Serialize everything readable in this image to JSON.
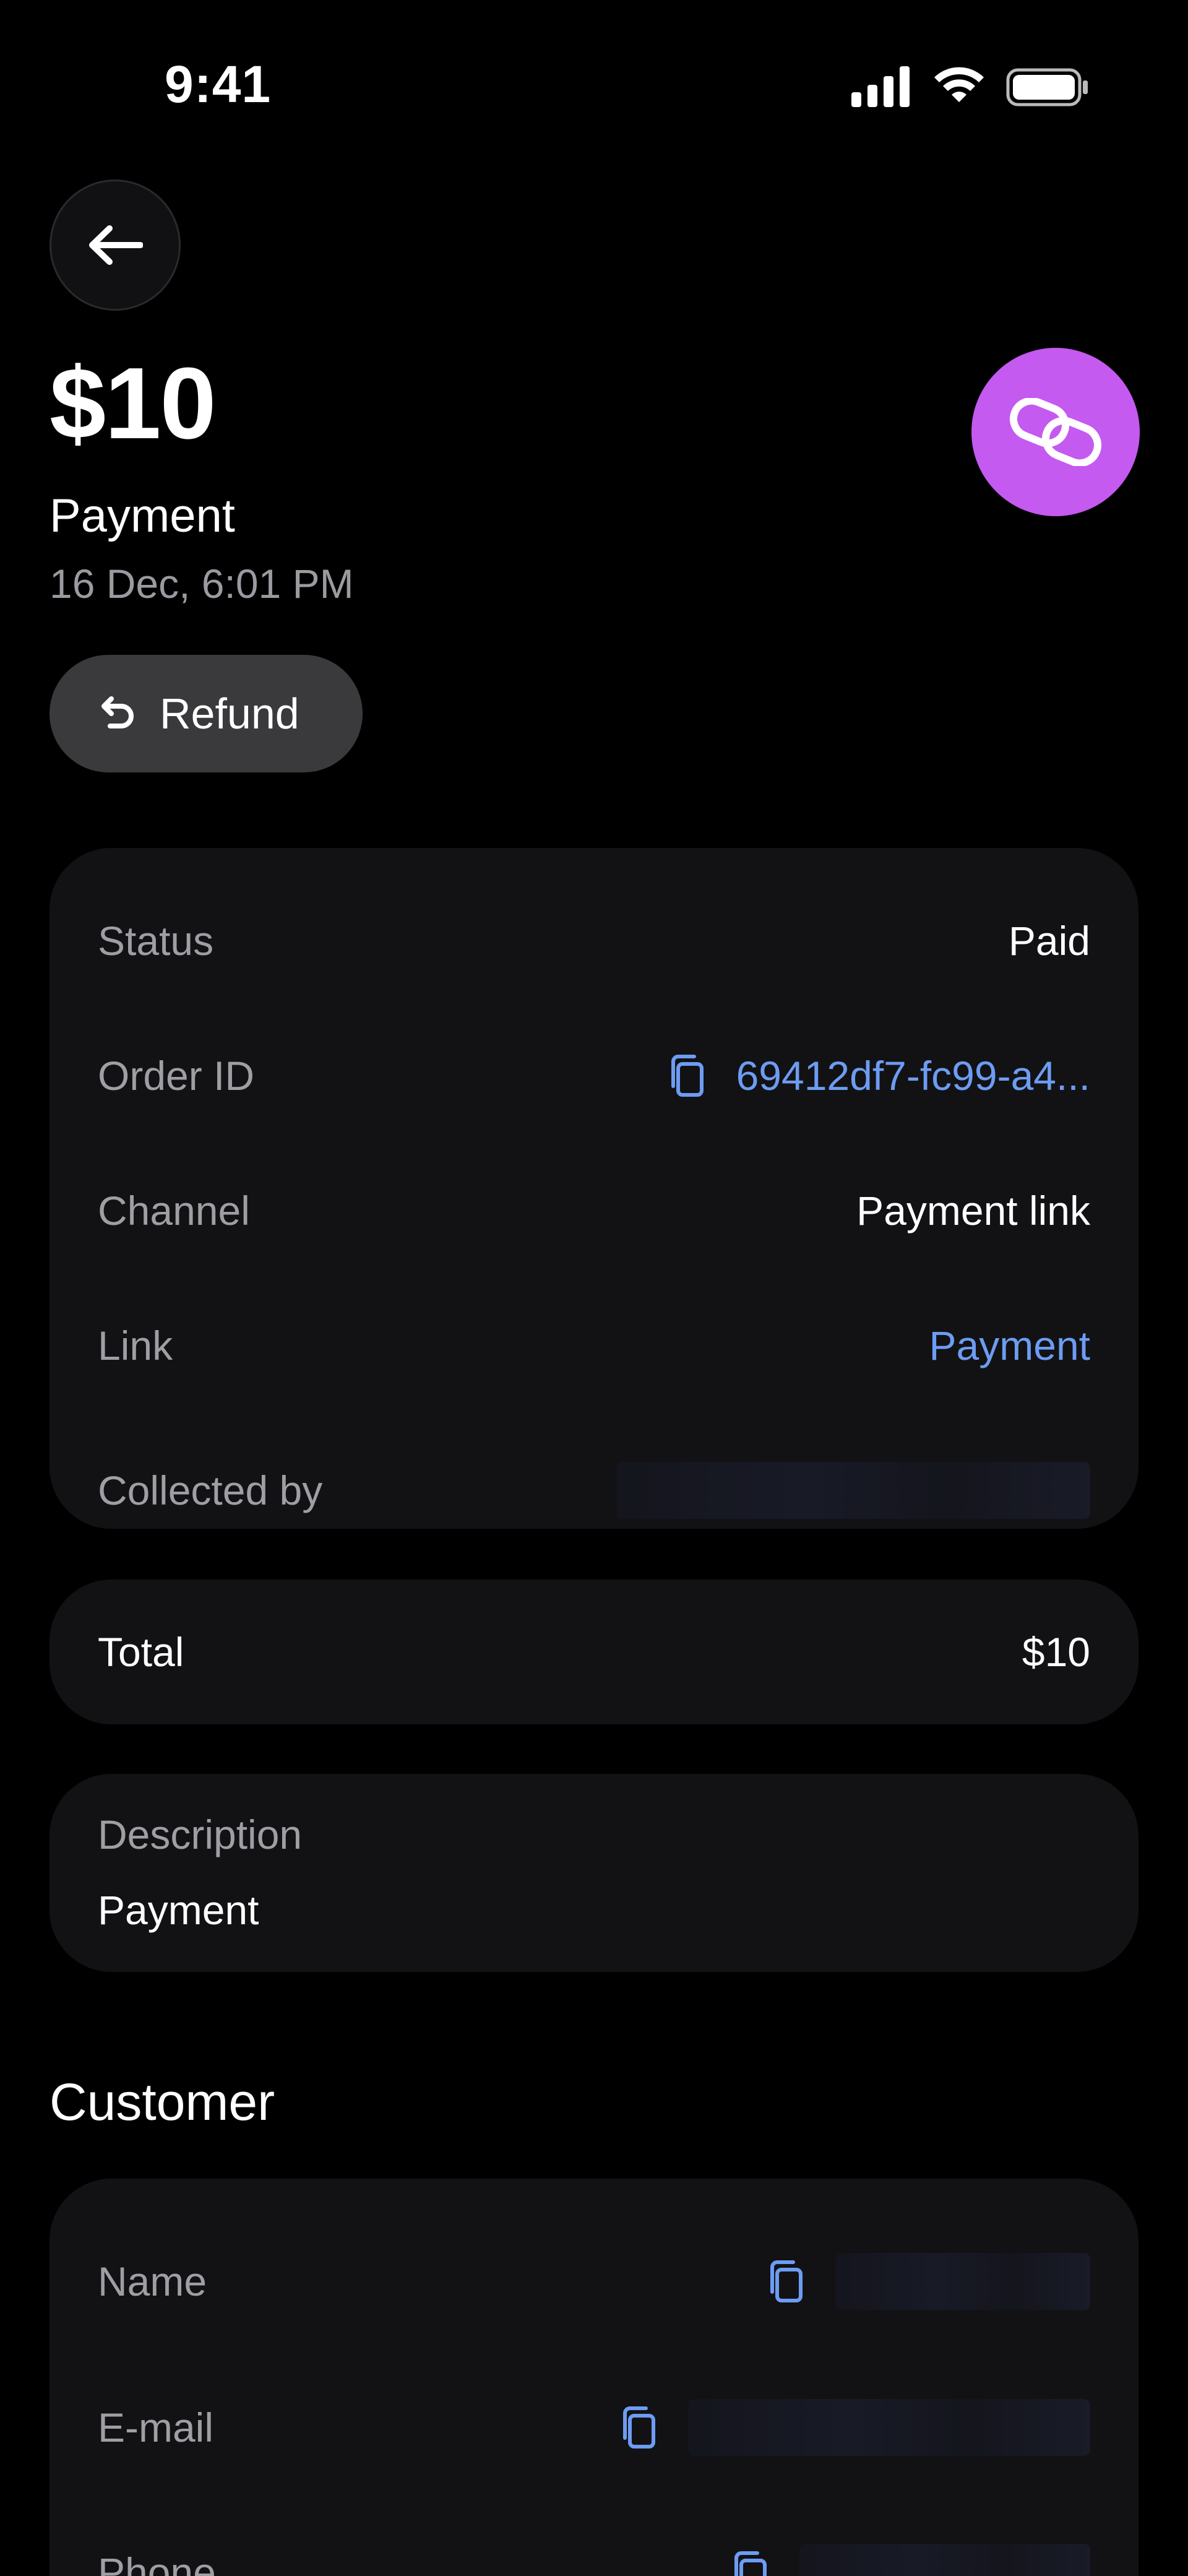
{
  "status_bar": {
    "time": "9:41",
    "icons": [
      "cellular-signal-icon",
      "wifi-icon",
      "battery-icon"
    ]
  },
  "header": {
    "back_icon": "arrow-left-icon",
    "amount": "$10",
    "title": "Payment",
    "date": "16 Dec, 6:01 PM",
    "badge_icon": "link-icon",
    "badge_color": "#c45af0",
    "refund_icon": "undo-icon",
    "refund_label": "Refund"
  },
  "details": {
    "status_label": "Status",
    "status_value": "Paid",
    "order_label": "Order ID",
    "order_value": "69412df7-fc99-a4...",
    "channel_label": "Channel",
    "channel_value": "Payment link",
    "link_label": "Link",
    "link_value": "Payment",
    "collected_label": "Collected by"
  },
  "total": {
    "label": "Total",
    "value": "$10"
  },
  "description": {
    "label": "Description",
    "value": "Payment"
  },
  "customer": {
    "section_title": "Customer",
    "name_label": "Name",
    "email_label": "E-mail",
    "phone_label": "Phone"
  },
  "colors": {
    "background": "#000000",
    "card": "#121214",
    "accent_blue": "#6d9cf3",
    "muted_text": "#9e9ea4"
  }
}
